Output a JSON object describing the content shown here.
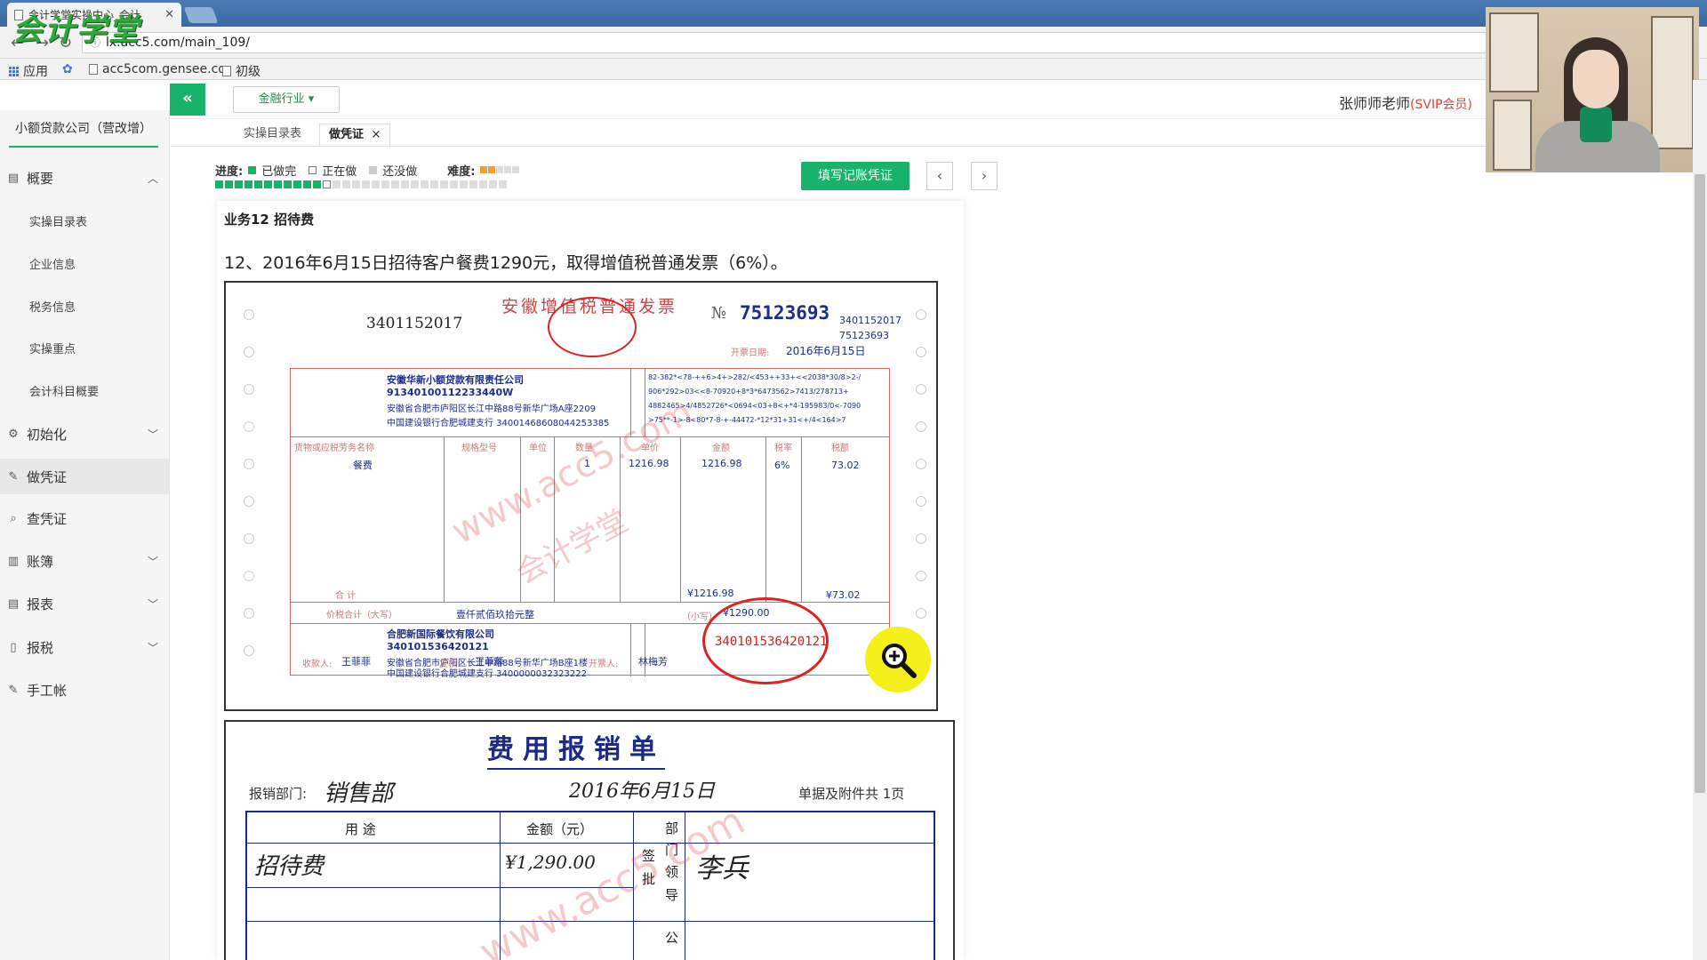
{
  "browser": {
    "tab_title": "会计学堂实操中心_会计",
    "url": "lx.acc5.com/main_109/",
    "bookmarks": [
      "应用",
      "acc5com.gensee.co",
      "初级"
    ],
    "logo_text": "会计学堂"
  },
  "header": {
    "industry": "金融行业 ▾",
    "teacher": "张师师老师",
    "member": "(SVIP会员)"
  },
  "sidebar": {
    "company": "小额贷款公司（营改增）",
    "overview": "概要",
    "sub_items": [
      "实操目录表",
      "企业信息",
      "税务信息",
      "实操重点",
      "会计科目概要"
    ],
    "items": [
      "初始化",
      "做凭证",
      "查凭证",
      "账簿",
      "报表",
      "报税",
      "手工帐"
    ]
  },
  "content_tabs": [
    "实操目录表",
    "做凭证"
  ],
  "progress": {
    "label": "进度:",
    "done": "已做完",
    "doing": "正在做",
    "todo": "还没做",
    "difficulty": "难度:",
    "difficulty_level": 2,
    "difficulty_max": 5,
    "total_steps": 30,
    "completed_steps": 11,
    "fill_button": "填写记账凭证"
  },
  "task": {
    "title": "业务12 招待费",
    "description": "12、2016年6月15日招待客户餐费1290元，取得增值税普通发票（6%）。"
  },
  "invoice": {
    "code": "3401152017",
    "title": "安徽增值税普通发票",
    "no_label": "№",
    "number": "75123693",
    "code_small": "3401152017",
    "number_small": "75123693",
    "date_label": "开票日期:",
    "date": "2016年6月15日",
    "buyer": {
      "name": "安徽华新小额贷款有限责任公司",
      "tax_id": "91340100112233440W",
      "address": "安徽省合肥市庐阳区长江中路88号新华广场A座2209",
      "bank": "中国建设银行合肥城建支行 34001468608044253385"
    },
    "cipher": [
      "82-382*<78-++6>4+>282/<453++33+<<2038*30/8>2-/",
      "906*292>03<<8-70920+8*3*6473562>7413/278713+",
      "4882465>4/4852726*<0694<03+8<+*4-195983/0<-7090",
      ">75**-1>-8<80*7-8-+-44472-*12*31+31<+/4<164>7"
    ],
    "item_headers": [
      "货物或应税劳务名称",
      "规格型号",
      "单位",
      "数量",
      "单价",
      "金额",
      "税率",
      "税额"
    ],
    "item": {
      "name": "餐费",
      "qty": "1",
      "price": "1216.98",
      "amount": "1216.98",
      "rate": "6%",
      "tax": "73.02"
    },
    "total_label": "合 计",
    "total_amount": "¥1216.98",
    "total_tax": "¥73.02",
    "price_tax_label": "价税合计（大写）",
    "price_tax_words": "壹仟贰佰玖拾元整",
    "small_label": "（小写）",
    "price_tax_num": "¥1290.00",
    "seller": {
      "name": "合肥新国际餐饮有限公司",
      "tax_id": "340101536420121",
      "address": "安徽省合肥市庐阳区长江中路88号新华广场B座1楼",
      "bank": "中国建设银行合肥城建支行 3400000032323222"
    },
    "payee_label": "收款人:",
    "payee": "王菲菲",
    "reviewer_label": "复核:",
    "reviewer": "王菲菲",
    "drawer_label": "开票人:",
    "drawer": "林梅芳",
    "seal_number": "340101536420121",
    "watermark_url": "www.acc5.com",
    "watermark_cn": "会计学堂"
  },
  "expense": {
    "title": "费用报销单",
    "dept_label": "报销部门:",
    "dept": "销售部",
    "date": "2016年6月15日",
    "attachments": "单据及附件共 1页",
    "col_purpose": "用 途",
    "col_amount": "金额（元）",
    "col_dept": "部门",
    "col_approve": "签批",
    "col_leader": "领导",
    "col_company": "公",
    "purpose": "招待费",
    "amount": "¥1,290.00",
    "approver": "李兵"
  }
}
